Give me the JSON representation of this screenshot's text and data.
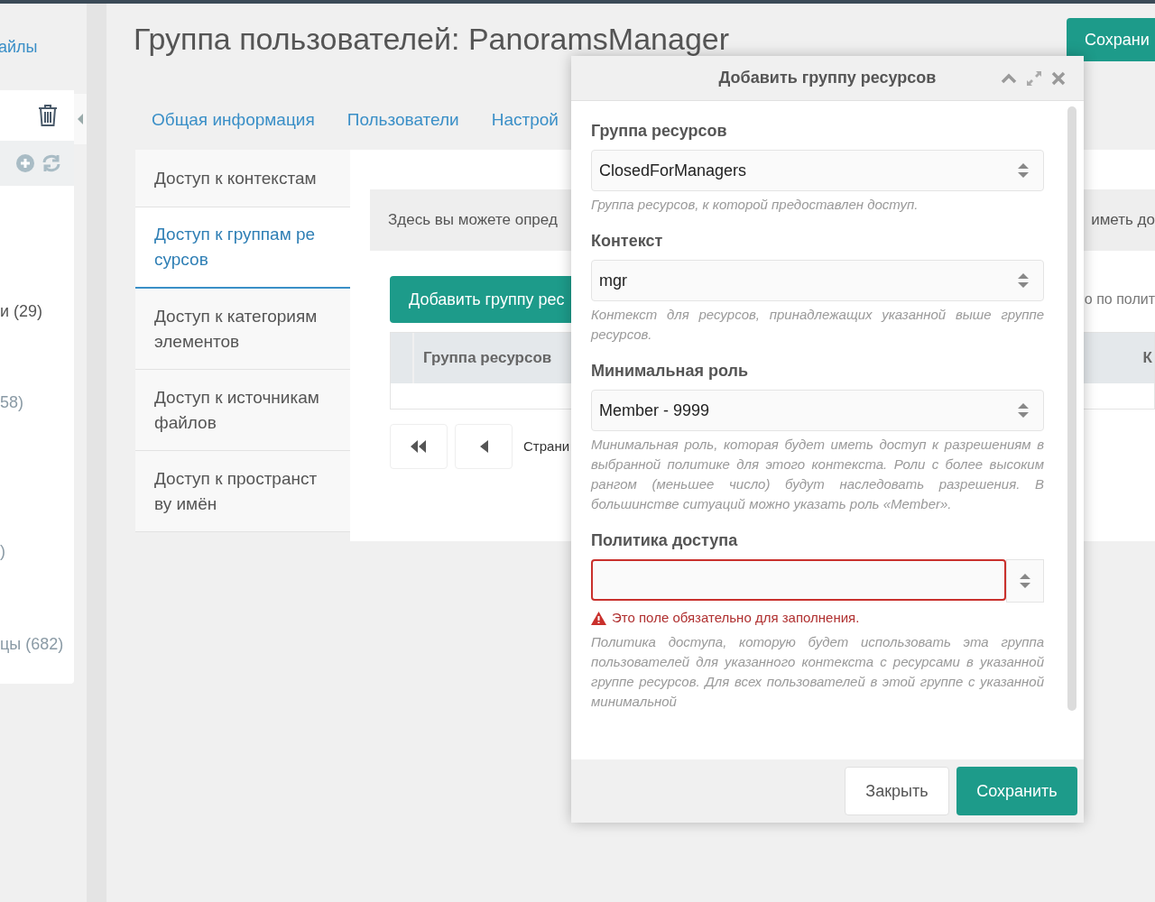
{
  "sidebar": {
    "link": "айлы",
    "tree_items": [
      "и (29)",
      "58)",
      ")",
      "цы (682)"
    ]
  },
  "page": {
    "title": "Группа пользователей: PanoramsManager",
    "save_button": "Сохрани",
    "tabs": [
      {
        "label": "Общая информация",
        "selected": false
      },
      {
        "label": "Пользователи",
        "selected": false
      },
      {
        "label": "Настрой",
        "selected": false
      }
    ],
    "vertical_tabs": [
      {
        "label": "Доступ к контекстам",
        "selected": false
      },
      {
        "label": "Доступ к группам ре сурсов",
        "selected": true
      },
      {
        "label": "Доступ к категориям элементов",
        "selected": false
      },
      {
        "label": "Доступ к источникам файлов",
        "selected": false
      },
      {
        "label": "Доступ к пространст ву имён",
        "selected": false
      }
    ],
    "description_left": "Здесь вы можете опред",
    "description_right": "иметь до",
    "add_button": "Добавить группу рес",
    "row_text": "о по полит",
    "grid": {
      "columns": [
        "Группа ресурсов",
        "К"
      ]
    },
    "pager_label": "Страни"
  },
  "dialog": {
    "title": "Добавить группу ресурсов",
    "fields": [
      {
        "label": "Группа ресурсов",
        "value": "ClosedForManagers",
        "invalid": false,
        "help": "Группа ресурсов, к которой предоставлен доступ."
      },
      {
        "label": "Контекст",
        "value": "mgr",
        "invalid": false,
        "help": "Контекст для ресурсов, принадлежащих указанной выше группе ресурсов."
      },
      {
        "label": "Минимальная роль",
        "value": "Member - 9999",
        "invalid": false,
        "help": "Минимальная роль, которая будет иметь доступ к разрешениям в выбранной политике для этого контекста. Роли с более высоким рангом (меньшее число) будут наследовать разрешения. В большинстве ситуаций можно указать роль «Member»."
      },
      {
        "label": "Политика доступа",
        "invalid": true,
        "error": "Это поле обязательно для заполнения.",
        "help": "Политика доступа, которую будет использовать эта группа пользователей для указанного контекста с ресурсами в указанной группе ресурсов. Для всех пользователей в этой группе с указанной минимальной"
      }
    ],
    "buttons": [
      {
        "label": "Закрыть",
        "kind": "secondary"
      },
      {
        "label": "Сохранить",
        "kind": "primary"
      }
    ]
  }
}
